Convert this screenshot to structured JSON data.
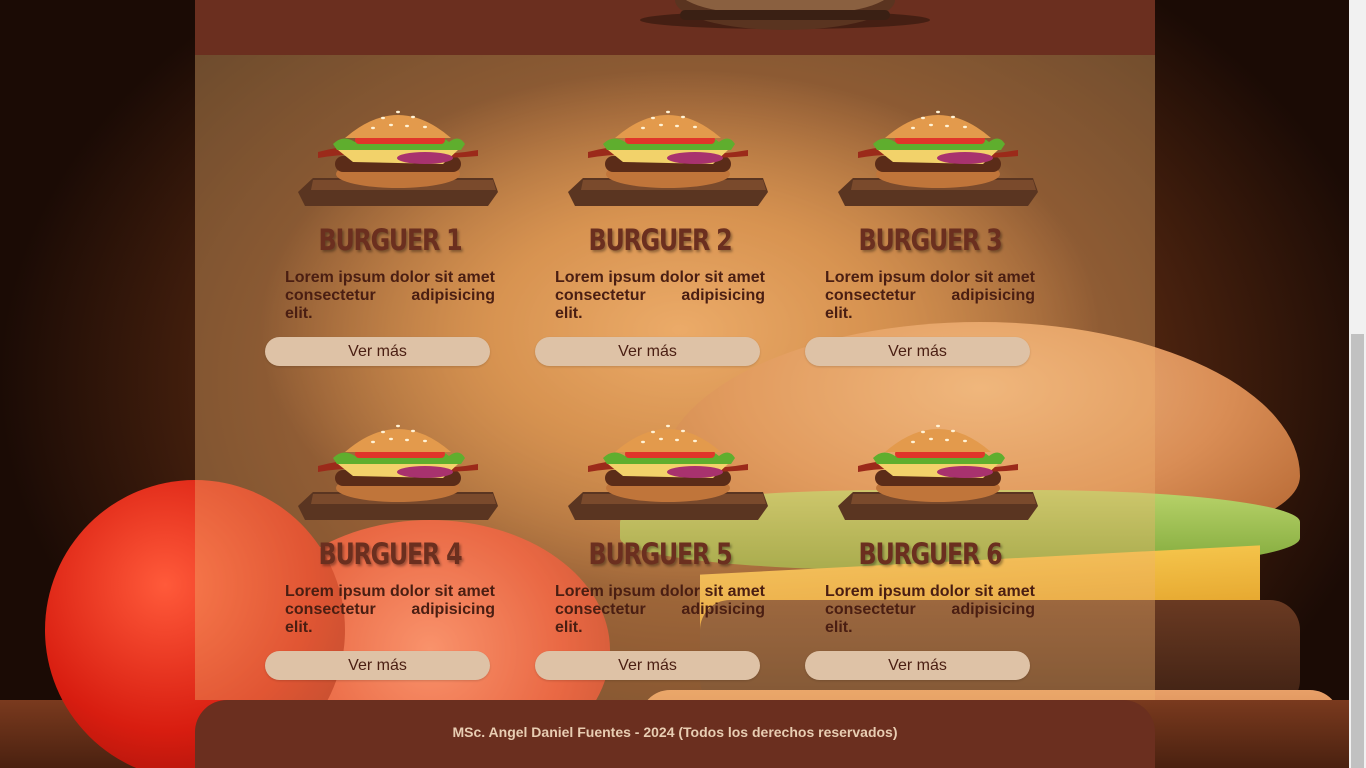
{
  "header": {
    "logo_icon": "burger-icon"
  },
  "products": [
    {
      "title": "BURGUER 1",
      "description": "Lorem ipsum dolor sit amet consectetur adipisicing elit.",
      "button_label": "Ver más",
      "image_icon": "burger-icon"
    },
    {
      "title": "BURGUER 2",
      "description": "Lorem ipsum dolor sit amet consectetur adipisicing elit.",
      "button_label": "Ver más",
      "image_icon": "burger-icon"
    },
    {
      "title": "BURGUER 3",
      "description": "Lorem ipsum dolor sit amet consectetur adipisicing elit.",
      "button_label": "Ver más",
      "image_icon": "burger-icon"
    },
    {
      "title": "BURGUER 4",
      "description": "Lorem ipsum dolor sit amet consectetur adipisicing elit.",
      "button_label": "Ver más",
      "image_icon": "burger-icon"
    },
    {
      "title": "BURGUER 5",
      "description": "Lorem ipsum dolor sit amet consectetur adipisicing elit.",
      "button_label": "Ver más",
      "image_icon": "burger-icon"
    },
    {
      "title": "BURGUER 6",
      "description": "Lorem ipsum dolor sit amet consectetur adipisicing elit.",
      "button_label": "Ver más",
      "image_icon": "burger-icon"
    }
  ],
  "footer": {
    "text": "MSc. Angel Daniel Fuentes - 2024 (Todos los derechos reservados)"
  },
  "colors": {
    "brand_brown": "#6b2f1f",
    "title_brown": "#6b2f1f",
    "text_dark": "#4a1e12",
    "button_bg": "#dec2a6",
    "footer_text": "#e8cdb2"
  }
}
